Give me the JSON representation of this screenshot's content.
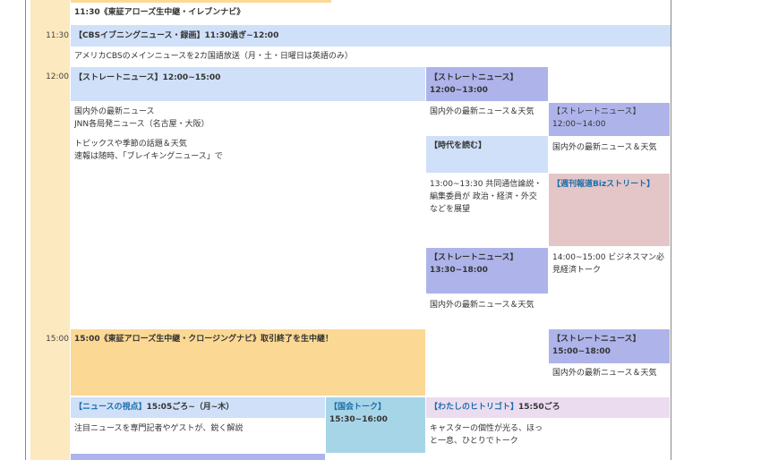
{
  "times": {
    "t1130": "11:30",
    "t1200": "12:00",
    "t1500": "15:00"
  },
  "rows": {
    "r1": "11:30《東証アローズ生中継・イレブンナビ》",
    "r2_title": "【CBSイブニングニュース・録画】11:30過ぎ~12:00",
    "r2_desc": "アメリカCBSのメインニュースを2カ国語放送（月・土・日曜日は英語のみ）",
    "sn_title": "【ストレートニュース】12:00~15:00",
    "sn_desc1": "国内外の最新ニュース",
    "sn_desc2": "JNN各局発ニュース（名古屋・大阪）",
    "sn_desc3": "トピックスや季節の話題＆天気",
    "sn_desc4": "速報は随時、「ブレイキングニュース」で",
    "c2a_title": "【ストレートニュース】12:00~13:00",
    "c2a_desc": "国内外の最新ニュース＆天気",
    "c2b_title": "【時代を読む】",
    "c2b_desc": "13:00~13:30 共同通信論説・編集委員が 政治・経済・外交などを展望",
    "c2c_title": "【ストレートニュース】13:30~18:00",
    "c2c_desc": "国内外の最新ニュース＆天気",
    "c3a_title": "【ストレートニュース】12:00~14:00",
    "c3a_desc": "国内外の最新ニュース＆天気",
    "c3b_title": "【週刊報道Bizストリート】",
    "c3b_desc": "14:00~15:00 ビジネスマン必見経済トーク",
    "c3c_title": "【ストレートニュース】15:00~18:00",
    "c3c_desc": "国内外の最新ニュース＆天気",
    "cl_title": "15:00《東証アローズ生中継・クロージングナビ》取引終了を生中継！",
    "nv_title_tag": "【ニュースの視点】",
    "nv_title_time": "15:05ごろ~（月~木）",
    "nv_desc": "注目ニュースを専門記者やゲストが、鋭く解説",
    "kt_title": "【国会トーク】",
    "kt_time": "15:30~16:00",
    "wh_title_tag": "【わたしのヒトリゴト】",
    "wh_title_time": "15:50ごろ",
    "wh_desc": "キャスターの個性が光る、ほっと一息、ひとりでトーク"
  }
}
